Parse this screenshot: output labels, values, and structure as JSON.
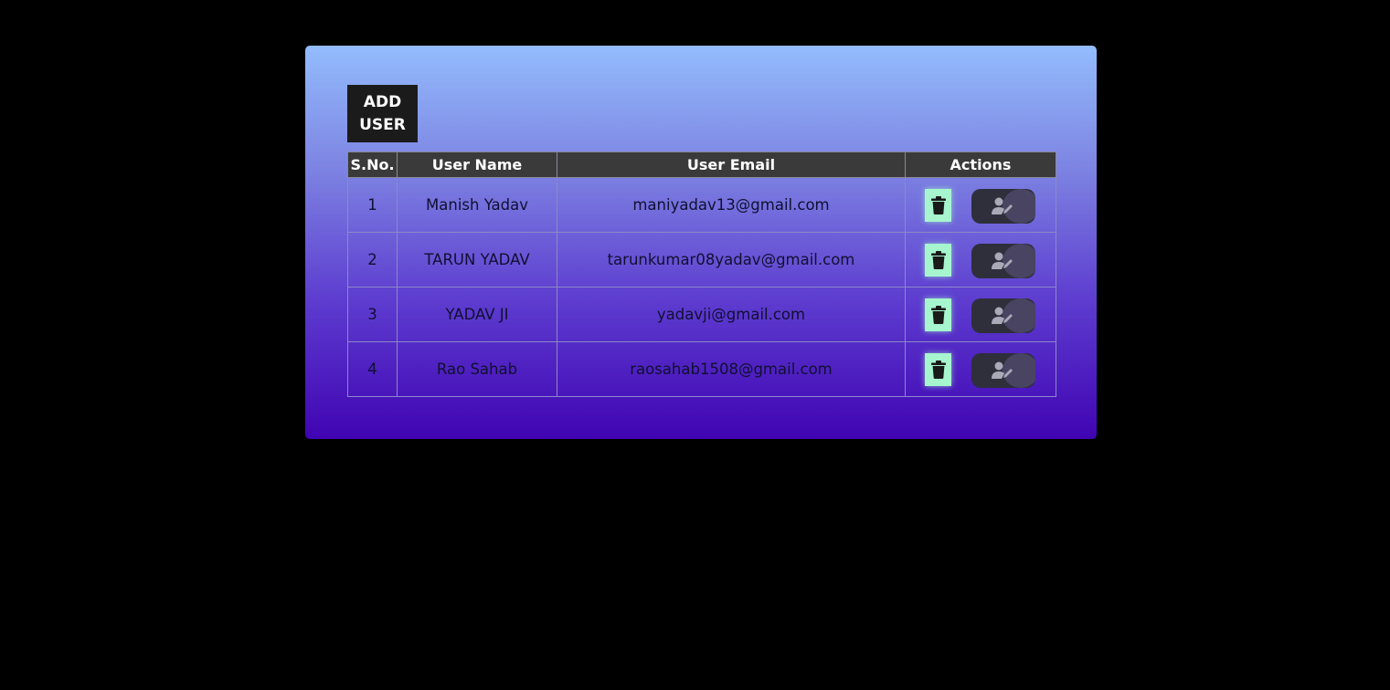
{
  "add_user_button": {
    "line1": "ADD",
    "line2": "USER"
  },
  "table": {
    "headers": {
      "sno": "S.No.",
      "name": "User Name",
      "email": "User Email",
      "actions": "Actions"
    },
    "rows": [
      {
        "sno": "1",
        "name": "Manish Yadav",
        "email": "maniyadav13@gmail.com"
      },
      {
        "sno": "2",
        "name": "TARUN YADAV",
        "email": "tarunkumar08yadav@gmail.com"
      },
      {
        "sno": "3",
        "name": "YADAV JI",
        "email": "yadavji@gmail.com"
      },
      {
        "sno": "4",
        "name": "Rao Sahab",
        "email": "raosahab1508@gmail.com"
      }
    ]
  },
  "icons": {
    "delete": "trash-icon",
    "edit": "user-edit-icon"
  },
  "colors": {
    "page_background": "#000000",
    "card_gradient_top": "#93bcfd",
    "card_gradient_bottom": "#4004b2",
    "header_background": "#3a3a3a",
    "delete_button": "#a6f5cf",
    "edit_button": "#2e2f3b",
    "add_button": "#1b1b1b"
  }
}
